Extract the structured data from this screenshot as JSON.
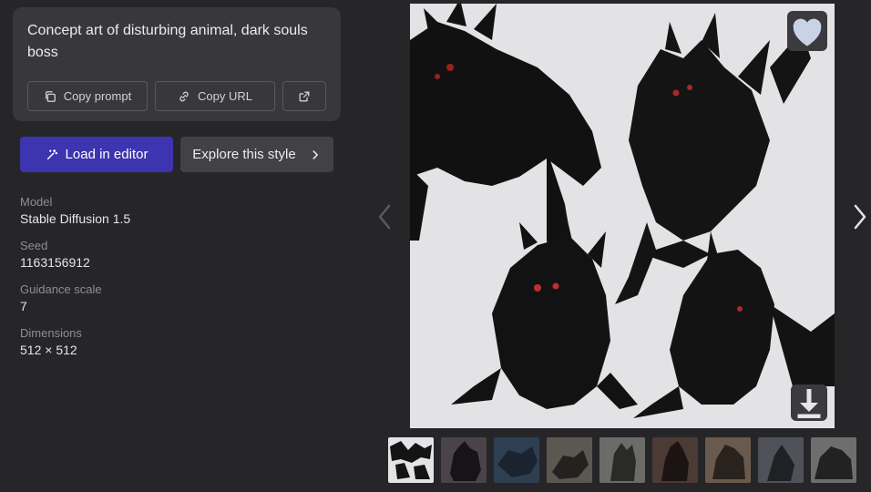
{
  "prompt": {
    "text": "Concept art of disturbing animal, dark souls boss",
    "copy_prompt_label": "Copy prompt",
    "copy_url_label": "Copy URL"
  },
  "actions": {
    "load_editor_label": "Load in editor",
    "explore_style_label": "Explore this style"
  },
  "details": [
    {
      "label": "Model",
      "value": "Stable Diffusion 1.5"
    },
    {
      "label": "Seed",
      "value": "1163156912"
    },
    {
      "label": "Guidance scale",
      "value": "7"
    },
    {
      "label": "Dimensions",
      "value": "512 × 512"
    }
  ],
  "icons": {
    "copy": "copy-icon",
    "link": "link-icon",
    "external": "external-link-icon",
    "wand": "magic-wand-icon",
    "chevron": "chevron-right-icon",
    "heart": "heart-icon",
    "download": "download-icon",
    "prev": "chevron-left-icon",
    "next": "chevron-right-icon"
  },
  "colors": {
    "background": "#262629",
    "card": "#37373c",
    "primary": "#3d34b0",
    "secondary": "#414146"
  },
  "thumbnails": [
    {
      "tone": "#e4e4e6",
      "fg": "#141414"
    },
    {
      "tone": "#4a4448",
      "fg": "#161416"
    },
    {
      "tone": "#2f3f52",
      "fg": "#1a2430"
    },
    {
      "tone": "#5a5850",
      "fg": "#23221f"
    },
    {
      "tone": "#6b6b68",
      "fg": "#2a2a28"
    },
    {
      "tone": "#4c3a34",
      "fg": "#1c1412"
    },
    {
      "tone": "#6a5a4e",
      "fg": "#2a221c"
    },
    {
      "tone": "#4f5258",
      "fg": "#1f2124"
    },
    {
      "tone": "#6e6e6e",
      "fg": "#222222"
    }
  ]
}
